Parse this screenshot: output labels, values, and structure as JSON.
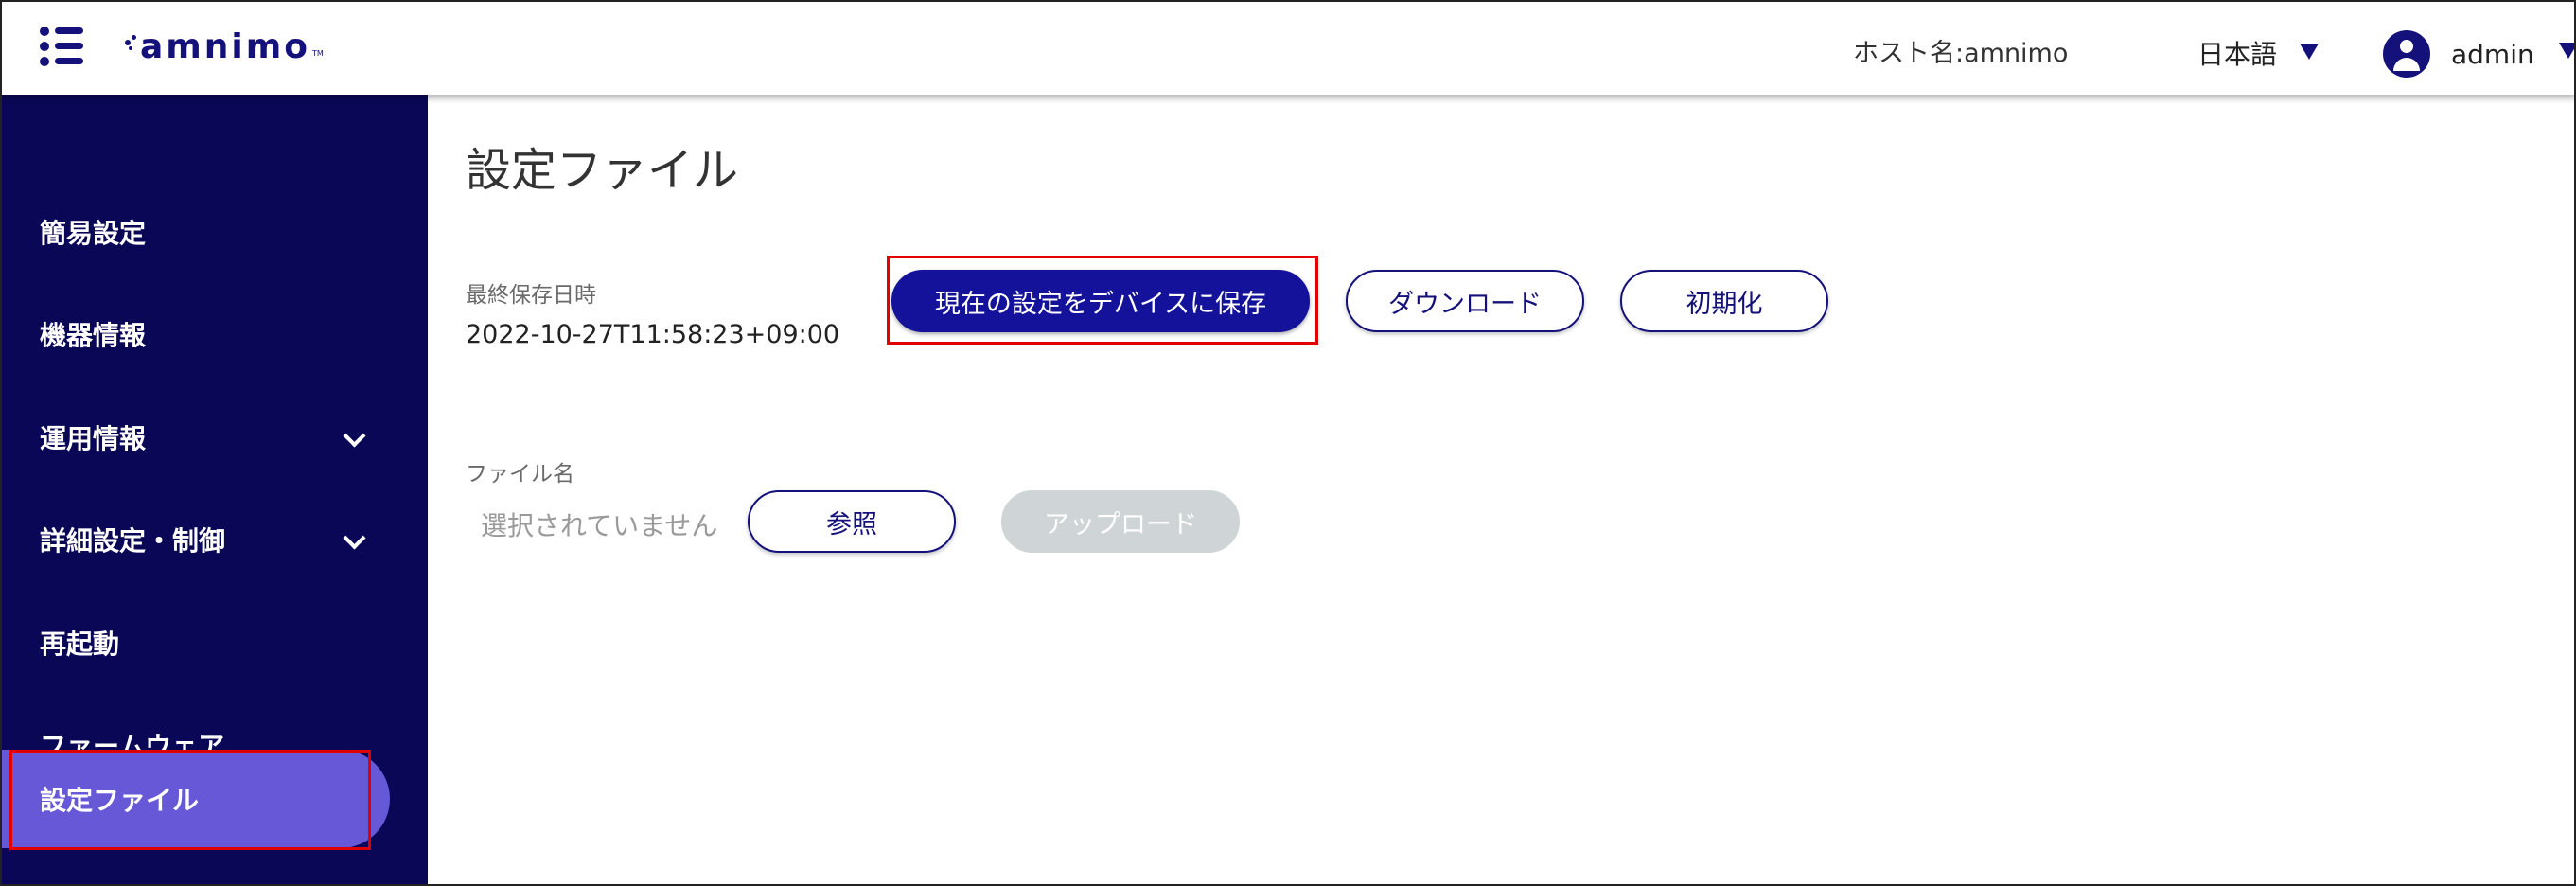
{
  "header": {
    "menu_icon": "menu-icon",
    "logo_text": "amnimo",
    "logo_tm": "TM",
    "host_label": "ホスト名:amnimo",
    "language": "日本語",
    "user": "admin",
    "accent_color": "#14127a"
  },
  "sidebar": {
    "background": "#0a0757",
    "active_color": "#6658d6",
    "items": [
      {
        "label": "簡易設定",
        "expandable": false
      },
      {
        "label": "機器情報",
        "expandable": false
      },
      {
        "label": "運用情報",
        "expandable": true
      },
      {
        "label": "詳細設定・制御",
        "expandable": true
      },
      {
        "label": "再起動",
        "expandable": false
      },
      {
        "label": "ファームウェア",
        "expandable": false
      },
      {
        "label": "設定ファイル",
        "expandable": false,
        "active": true
      }
    ]
  },
  "main": {
    "title": "設定ファイル",
    "last_saved_label": "最終保存日時",
    "last_saved_value": "2022-10-27T11:58:23+09:00",
    "save_button": "現在の設定をデバイスに保存",
    "download_button": "ダウンロード",
    "reset_button": "初期化",
    "file_name_label": "ファイル名",
    "file_placeholder": "選択されていません",
    "browse_button": "参照",
    "upload_button": "アップロード",
    "upload_disabled": true
  },
  "annotations": {
    "highlight_color": "#e00000"
  }
}
